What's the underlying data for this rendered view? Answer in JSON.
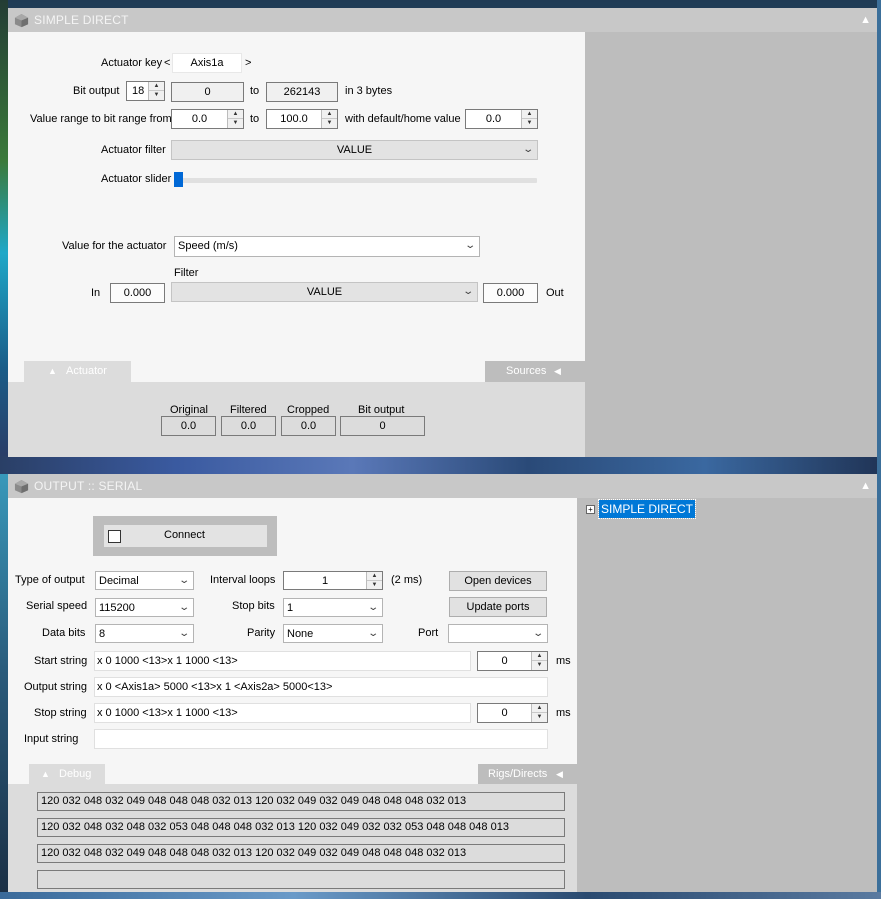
{
  "window1": {
    "title": "SIMPLE DIRECT",
    "logo_icon": "cube-logo-icon",
    "collapse_icon": "triangle-up-icon",
    "actuator_key_label": "Actuator key",
    "actuator_key_value": "Axis1a",
    "prev_arrow": "<",
    "next_arrow": ">",
    "bit_output_label": "Bit output",
    "bit_output_value": "18",
    "bit_from": "0",
    "to_label": "to",
    "bit_to": "262143",
    "bytes_label": "in 3 bytes",
    "value_range_label": "Value range to bit range from",
    "range_from": "0.0",
    "range_to": "100.0",
    "default_label": "with default/home value",
    "default_value": "0.0",
    "actuator_filter_label": "Actuator filter",
    "actuator_filter_value": "VALUE",
    "actuator_slider_label": "Actuator slider",
    "actuator_slider_level": 0,
    "value_for_actuator_label": "Value for the actuator",
    "value_for_actuator_value": "Speed (m/s)",
    "filter_label": "Filter",
    "in_label": "In",
    "in_value": "0.000",
    "filter_value": "VALUE",
    "out_value": "0.000",
    "out_label": "Out",
    "tab_actuator": "Actuator",
    "tab_sources": "Sources",
    "readout_headers": [
      "Original",
      "Filtered",
      "Cropped",
      "Bit output"
    ],
    "readout_values": [
      "0.0",
      "0.0",
      "0.0",
      "0"
    ]
  },
  "window2": {
    "title": "OUTPUT :: SERIAL",
    "connect_label": "Connect",
    "connect_checked": false,
    "type_of_output_label": "Type of output",
    "type_of_output_value": "Decimal",
    "interval_loops_label": "Interval loops",
    "interval_loops_value": "1",
    "interval_unit": "(2 ms)",
    "open_devices_label": "Open devices",
    "serial_speed_label": "Serial speed",
    "serial_speed_value": "115200",
    "stop_bits_label": "Stop bits",
    "stop_bits_value": "1",
    "update_ports_label": "Update ports",
    "data_bits_label": "Data bits",
    "data_bits_value": "8",
    "parity_label": "Parity",
    "parity_value": "None",
    "port_label": "Port",
    "port_value": "",
    "start_string_label": "Start string",
    "start_string_value": "x 0 1000 <13>x 1 1000 <13>",
    "start_delay": "0",
    "ms_label": "ms",
    "output_string_label": "Output string",
    "output_string_value": "x 0 <Axis1a> 5000 <13>x 1 <Axis2a> 5000<13>",
    "stop_string_label": "Stop string",
    "stop_string_value": "x 0 1000 <13>x 1 1000 <13>",
    "stop_delay": "0",
    "input_string_label": "Input string",
    "input_string_value": "",
    "tab_debug": "Debug",
    "tab_rigs": "Rigs/Directs",
    "debug_lines": [
      "120 032 048 032 049 048 048 048 032 013 120 032 049 032 049 048 048 048 032 013",
      "120 032 048 032 048 032 053 048 048 048 032 013 120 032 049 032 032 053 048 048 048 013",
      "120 032 048 032 049 048 048 048 032 013 120 032 049 032 049 048 048 048 032 013",
      ""
    ],
    "tree_item": "SIMPLE DIRECT",
    "tree_expand_icon": "plus-box-icon"
  }
}
